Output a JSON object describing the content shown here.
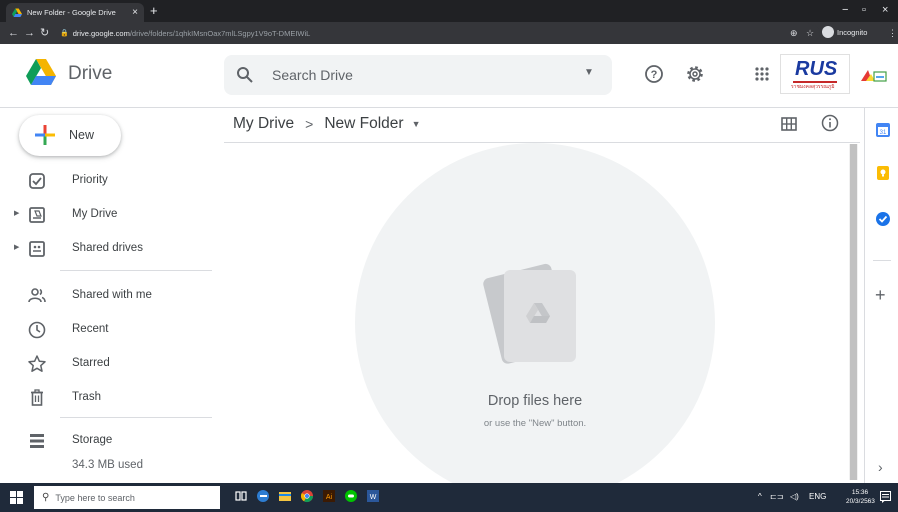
{
  "browser": {
    "tab_title": "New Folder - Google Drive",
    "tab_close": "×",
    "new_tab": "+",
    "url_host": "drive.google.com",
    "url_path": "/drive/folders/1qhkIMsnOax7mlLSgpy1V9oT-DMEIWiL",
    "incognito_label": "Incognito",
    "window_controls": [
      "−",
      "▫",
      "×"
    ]
  },
  "header": {
    "product_name": "Drive",
    "search_placeholder": "Search Drive",
    "brand_badge_text": "RUS",
    "brand_badge_sub": "ราชมงคลสุวรรณภูมิ"
  },
  "sidebar": {
    "new_button_label": "New",
    "items": [
      {
        "label": "Priority",
        "icon": "priority-icon"
      },
      {
        "label": "My Drive",
        "icon": "my-drive-icon",
        "expandable": true
      },
      {
        "label": "Shared drives",
        "icon": "shared-drives-icon",
        "expandable": true
      },
      {
        "label": "Shared with me",
        "icon": "shared-with-me-icon"
      },
      {
        "label": "Recent",
        "icon": "recent-clock-icon"
      },
      {
        "label": "Starred",
        "icon": "star-icon"
      },
      {
        "label": "Trash",
        "icon": "trash-icon"
      }
    ],
    "storage_label": "Storage",
    "storage_used": "34.3 MB used"
  },
  "main": {
    "breadcrumb_root": "My Drive",
    "breadcrumb_sep": ">",
    "breadcrumb_current": "New Folder",
    "empty_title": "Drop files here",
    "empty_subtitle": "or use the \"New\" button."
  },
  "taskbar": {
    "search_placeholder": "Type here to search",
    "language": "ENG",
    "time": "15:36",
    "date": "20/3/2563"
  },
  "colors": {
    "drive_blue": "#4285f4",
    "drive_green": "#0f9d58",
    "drive_yellow": "#f4b400",
    "drive_red": "#db4437",
    "browser_dark": "#35363a",
    "taskbar": "#1f2a3a"
  }
}
